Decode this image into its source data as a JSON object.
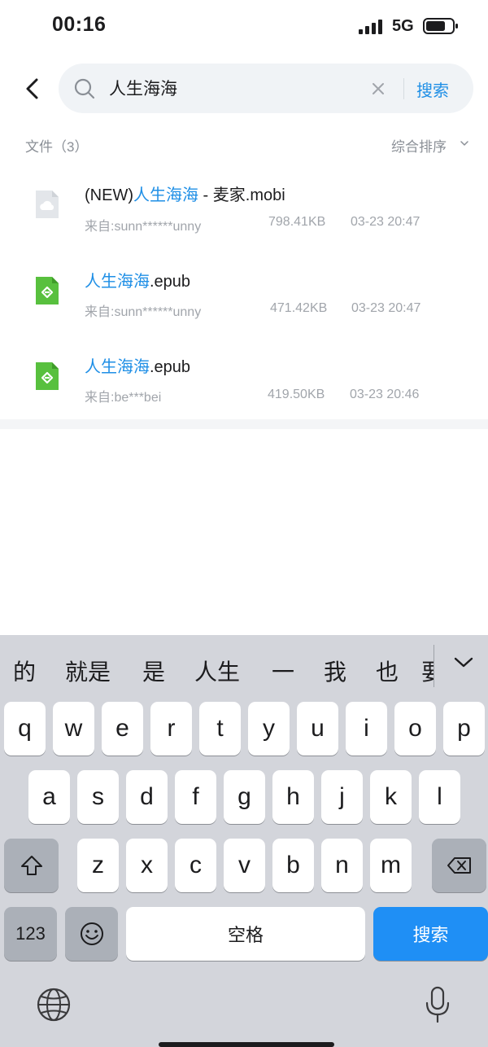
{
  "status": {
    "time": "00:16",
    "network": "5G"
  },
  "search": {
    "query": "人生海海",
    "button_label": "搜索"
  },
  "section": {
    "title": "文件（3）",
    "sort_label": "综合排序"
  },
  "files": [
    {
      "prefix": "(NEW)",
      "highlight": "人生海海",
      "suffix": " - 麦家.mobi",
      "source": "来自:sunn******unny",
      "size": "798.41KB",
      "date": "03-23 20:47",
      "icon": "cloud-file-icon"
    },
    {
      "prefix": "",
      "highlight": "人生海海",
      "suffix": ".epub",
      "source": "来自:sunn******unny",
      "size": "471.42KB",
      "date": "03-23 20:47",
      "icon": "epub-file-icon"
    },
    {
      "prefix": "",
      "highlight": "人生海海",
      "suffix": ".epub",
      "source": "来自:be***bei",
      "size": "419.50KB",
      "date": "03-23 20:46",
      "icon": "epub-file-icon"
    }
  ],
  "keyboard": {
    "candidates": [
      "的",
      "就是",
      "是",
      "人生",
      "一",
      "我",
      "也",
      "要"
    ],
    "row1": [
      "q",
      "w",
      "e",
      "r",
      "t",
      "y",
      "u",
      "i",
      "o",
      "p"
    ],
    "row2": [
      "a",
      "s",
      "d",
      "f",
      "g",
      "h",
      "j",
      "k",
      "l"
    ],
    "row3": [
      "z",
      "x",
      "c",
      "v",
      "b",
      "n",
      "m"
    ],
    "num_label": "123",
    "space_label": "空格",
    "search_label": "搜索"
  }
}
